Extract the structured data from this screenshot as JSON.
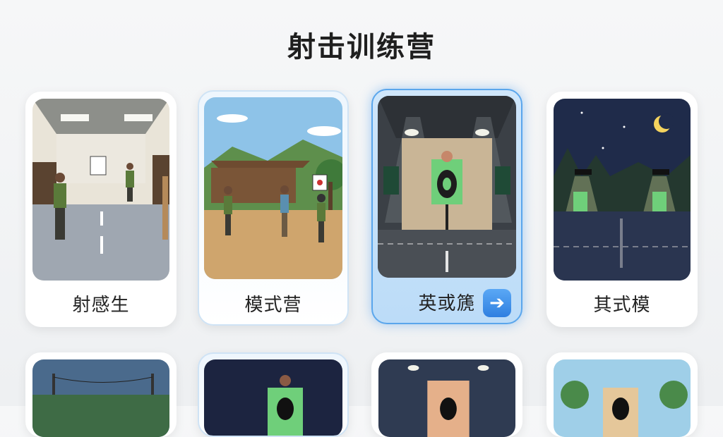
{
  "page": {
    "title": "射击训练营"
  },
  "cards": [
    {
      "label": "射感生",
      "scene": "indoor-range"
    },
    {
      "label": "模式营",
      "scene": "outdoor-range"
    },
    {
      "label": "英或篪",
      "scene": "target-room",
      "selected": true,
      "action_icon": "arrow-right-icon"
    },
    {
      "label": "其式模",
      "scene": "night-range"
    }
  ],
  "row2_scenes": [
    "outdoor-road",
    "night-target",
    "spotlight-target",
    "forest-target"
  ],
  "colors": {
    "accent": "#3a8ee6",
    "selected_bg": "#c9e3fa"
  }
}
